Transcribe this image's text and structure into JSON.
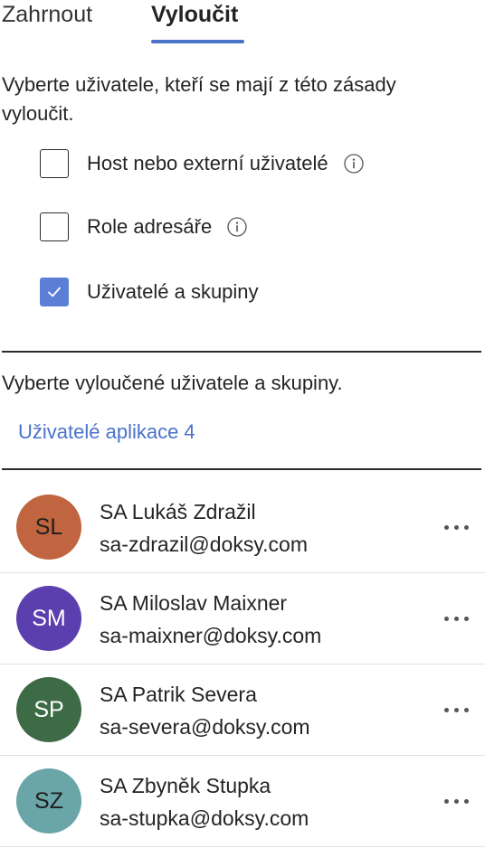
{
  "tabs": {
    "include_label": "Zahrnout",
    "exclude_label": "Vyloučit",
    "active": "Vyloučit"
  },
  "instructions": "Vyberte uživatele, kteří se mají z této zásady vyloučit.",
  "options": [
    {
      "label": "Host nebo externí uživatelé",
      "checked": false,
      "has_info": true
    },
    {
      "label": "Role adresáře",
      "checked": false,
      "has_info": true
    },
    {
      "label": "Uživatelé a skupiny",
      "checked": true,
      "has_info": false
    }
  ],
  "selection_label": "Vyberte vyloučené uživatele a skupiny.",
  "selection_link": "Uživatelé aplikace 4",
  "users": [
    {
      "initials": "SL",
      "name": "SA Lukáš Zdražil",
      "email": "sa-zdrazil@doksy.com",
      "avatar_color": "#c0653f",
      "initials_color": "#1f1f1f"
    },
    {
      "initials": "SM",
      "name": "SA Miloslav Maixner",
      "email": "sa-maixner@doksy.com",
      "avatar_color": "#5b3fae",
      "initials_color": "#ffffff"
    },
    {
      "initials": "SP",
      "name": "SA Patrik Severa",
      "email": "sa-severa@doksy.com",
      "avatar_color": "#3d6b45",
      "initials_color": "#ffffff"
    },
    {
      "initials": "SZ",
      "name": "SA Zbyněk Stupka",
      "email": "sa-stupka@doksy.com",
      "avatar_color": "#6aa6a8",
      "initials_color": "#1f1f1f"
    }
  ],
  "colors": {
    "accent": "#4a72c9",
    "checkbox_checked": "#5b7fd6"
  }
}
